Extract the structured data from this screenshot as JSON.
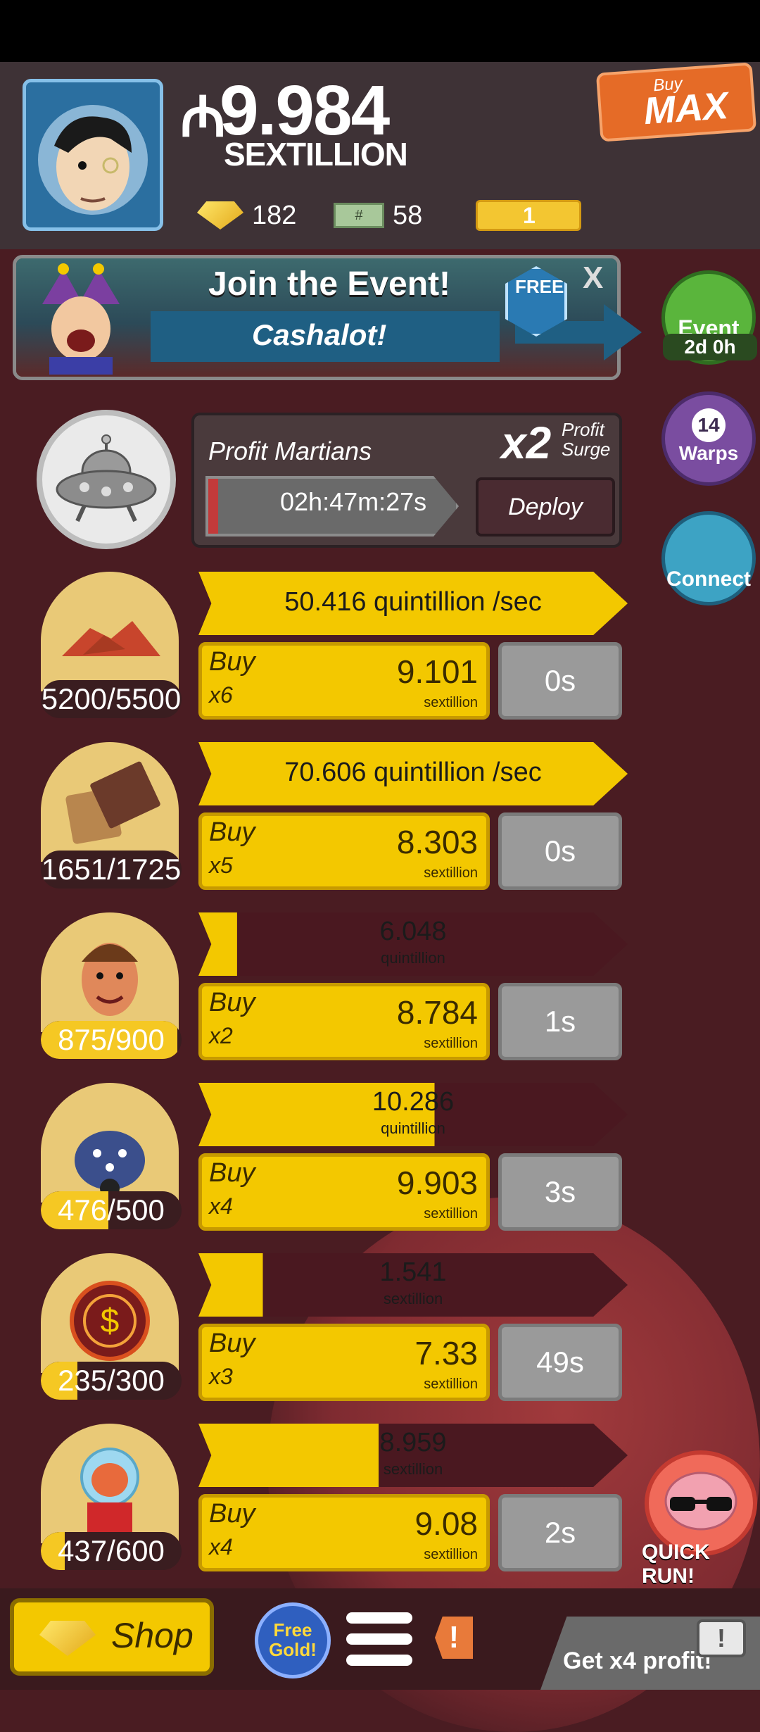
{
  "currency": {
    "symbol": "₼",
    "value": "9.984",
    "unit": "SEXTILLION",
    "gold": "182",
    "megabucks": "58",
    "tickets": "1",
    "bill_icon": "#"
  },
  "buy_max": {
    "small": "Buy",
    "big": "MAX"
  },
  "event": {
    "title": "Join the Event!",
    "subtitle": "Cashalot!",
    "free_label": "FREE",
    "close": "X"
  },
  "side": {
    "event_label": "Event",
    "event_timer": "2d 0h",
    "warps_count": "14",
    "warps_label": "Warps",
    "connect_label": "Connect"
  },
  "martians": {
    "name": "Profit Martians",
    "multiplier": "x2",
    "mult_label_1": "Profit",
    "mult_label_2": "Surge",
    "timer": "02h:47m:27s",
    "deploy": "Deploy",
    "timer_progress": 0.04
  },
  "businesses": [
    {
      "count": "5200/5500",
      "count_fill": 0.0,
      "prod_main": "50.416 quintillion /sec",
      "prod_sub": "",
      "prod_fill": 1.0,
      "buy_line1": "Buy",
      "buy_line2": "x6",
      "cost": "9.101",
      "cost_unit": "sextillion",
      "time": "0s",
      "icon": "red-ore-icon",
      "color": "#c8452c"
    },
    {
      "count": "1651/1725",
      "count_fill": 0.0,
      "prod_main": "70.606 quintillion /sec",
      "prod_sub": "",
      "prod_fill": 1.0,
      "buy_line1": "Buy",
      "buy_line2": "x5",
      "cost": "8.303",
      "cost_unit": "sextillion",
      "time": "0s",
      "icon": "chocolate-bar-icon",
      "color": "#6b3a2a"
    },
    {
      "count": "875/900",
      "count_fill": 0.97,
      "prod_main": "6.048",
      "prod_sub": "quintillion",
      "prod_fill": 0.09,
      "buy_line1": "Buy",
      "buy_line2": "x2",
      "cost": "8.784",
      "cost_unit": "sextillion",
      "time": "1s",
      "icon": "smiling-face-icon",
      "color": "#e0885a"
    },
    {
      "count": "476/500",
      "count_fill": 0.48,
      "prod_main": "10.286",
      "prod_sub": "quintillion",
      "prod_fill": 0.55,
      "buy_line1": "Buy",
      "buy_line2": "x4",
      "cost": "9.903",
      "cost_unit": "sextillion",
      "time": "3s",
      "icon": "beetle-icon",
      "color": "#3b4f8c"
    },
    {
      "count": "235/300",
      "count_fill": 0.26,
      "prod_main": "1.541",
      "prod_sub": "sextillion",
      "prod_fill": 0.15,
      "buy_line1": "Buy",
      "buy_line2": "x3",
      "cost": "7.33",
      "cost_unit": "sextillion",
      "time": "49s",
      "icon": "coin-portal-icon",
      "color": "#d9501e"
    },
    {
      "count": "437/600",
      "count_fill": 0.17,
      "prod_main": "8.959",
      "prod_sub": "sextillion",
      "prod_fill": 0.42,
      "buy_line1": "Buy",
      "buy_line2": "x4",
      "cost": "9.08",
      "cost_unit": "sextillion",
      "time": "2s",
      "icon": "alien-astronaut-icon",
      "color": "#e86a3c"
    }
  ],
  "quick_run": "QUICK RUN!",
  "bottom": {
    "shop": "Shop",
    "free_gold": "Free Gold!",
    "alert": "!",
    "get_profit": "Get x4 profit!",
    "tv_symbol": "!"
  }
}
